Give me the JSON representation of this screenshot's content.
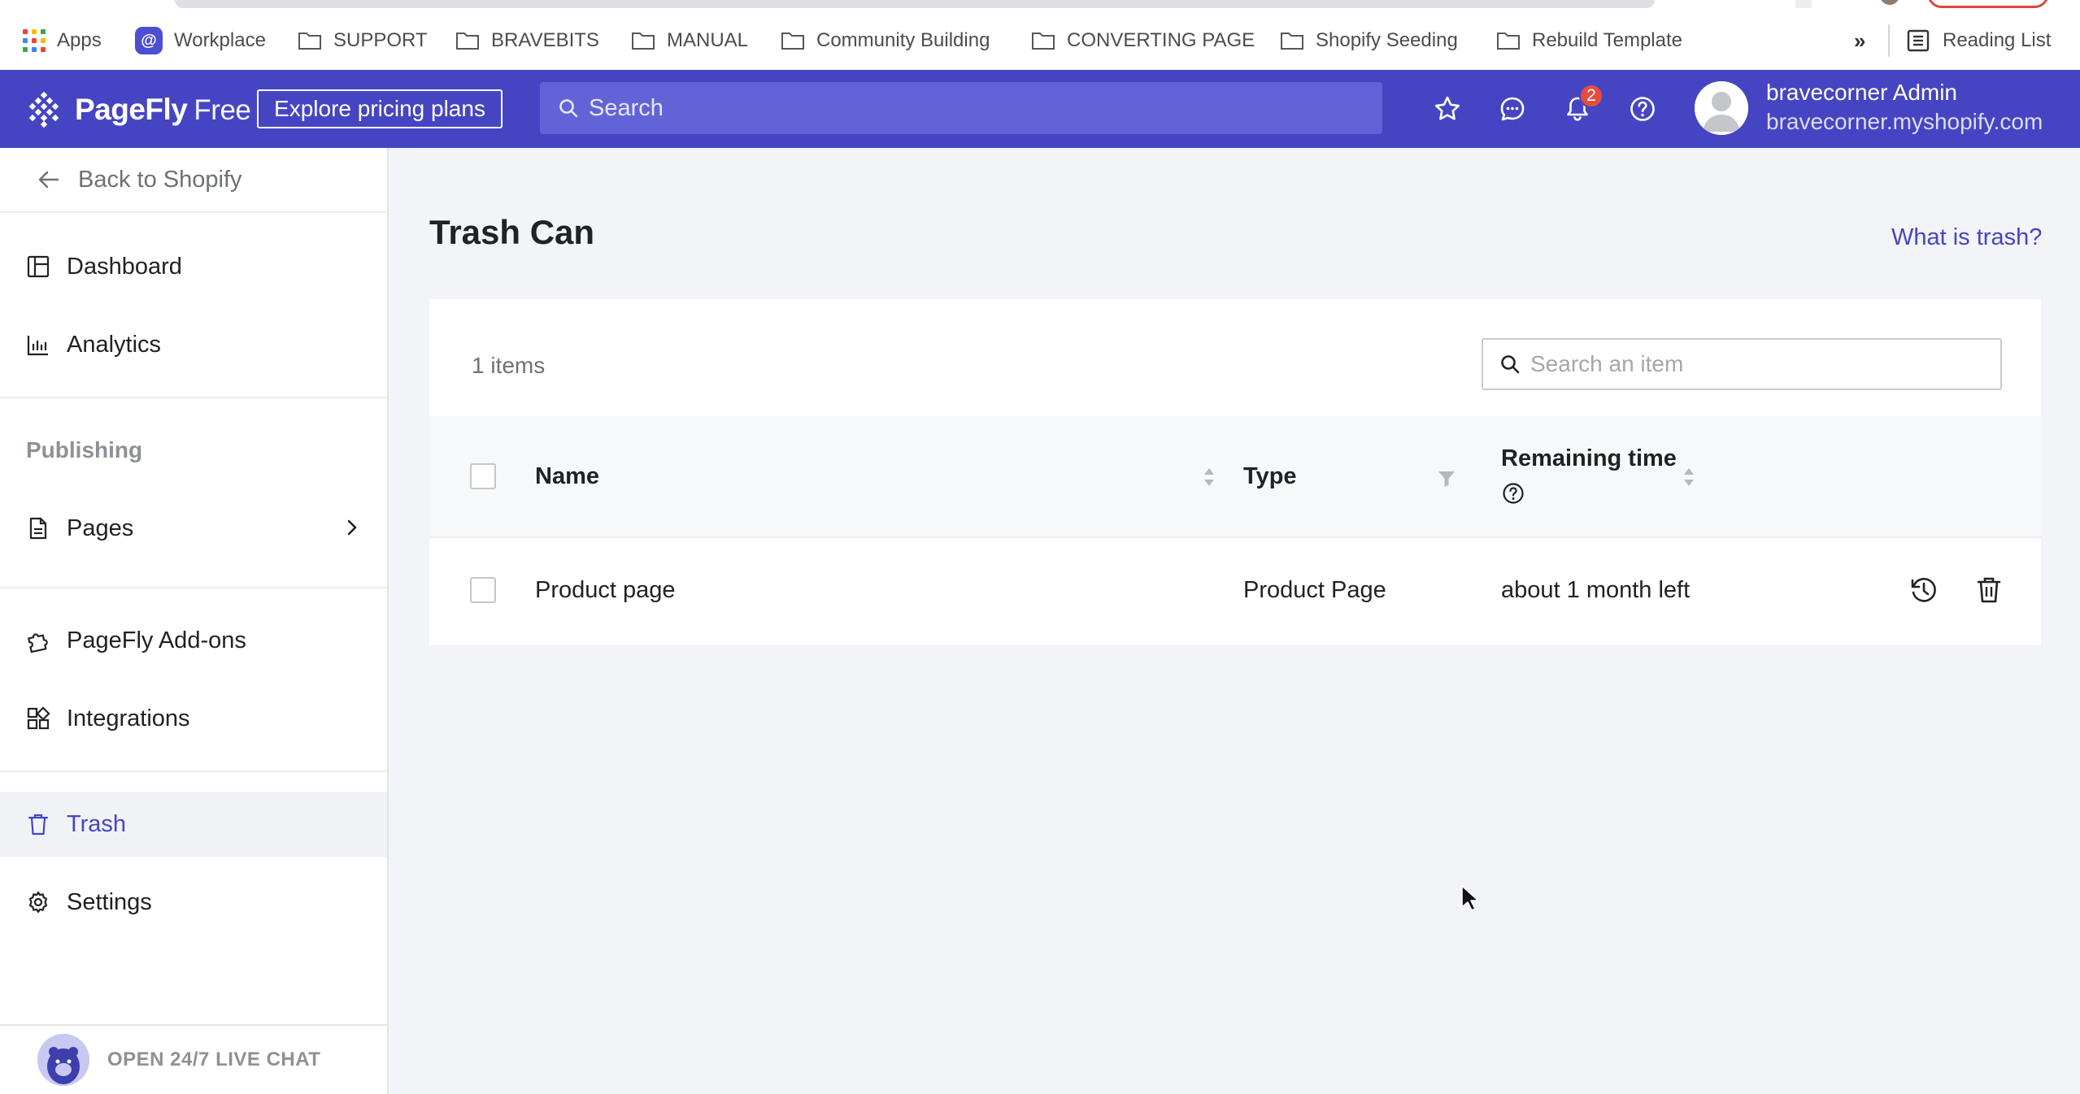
{
  "bookmarks": {
    "items": [
      {
        "label": "Apps"
      },
      {
        "label": "Workplace"
      },
      {
        "label": "SUPPORT"
      },
      {
        "label": "BRAVEBITS"
      },
      {
        "label": "MANUAL"
      },
      {
        "label": "Community Building"
      },
      {
        "label": "CONVERTING PAGE"
      },
      {
        "label": "Shopify Seeding"
      },
      {
        "label": "Rebuild Template"
      }
    ],
    "overflow": "»",
    "reading_list": "Reading List"
  },
  "appbar": {
    "brand": "PageFly",
    "plan": "Free",
    "pricing_button": "Explore pricing plans",
    "search_placeholder": "Search",
    "notification_count": "2",
    "user_name": "bravecorner Admin",
    "user_store": "bravecorner.myshopify.com",
    "accent_color": "#4545c4"
  },
  "sidebar": {
    "back": "Back to Shopify",
    "dashboard": "Dashboard",
    "analytics": "Analytics",
    "publishing_title": "Publishing",
    "pages": "Pages",
    "addons": "PageFly Add-ons",
    "integrations": "Integrations",
    "trash": "Trash",
    "settings": "Settings",
    "live_chat": "OPEN 24/7 LIVE CHAT"
  },
  "main": {
    "title": "Trash Can",
    "help_link": "What is trash?",
    "items_count": "1 items",
    "search_placeholder": "Search an item",
    "columns": {
      "name": "Name",
      "type": "Type",
      "remaining": "Remaining time"
    },
    "rows": [
      {
        "name": "Product page",
        "type": "Product Page",
        "remaining": "about 1 month left"
      }
    ]
  }
}
